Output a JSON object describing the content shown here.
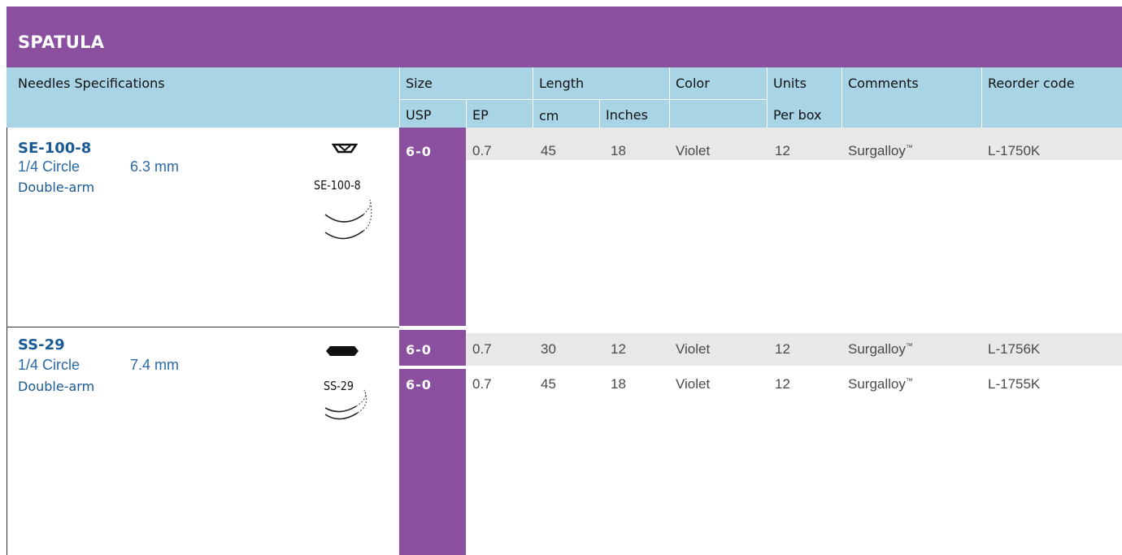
{
  "section_title": "SPATULA",
  "header": {
    "needles": "Needles Specifications",
    "size": "Size",
    "usp": "USP",
    "ep": "EP",
    "length": "Length",
    "cm": "cm",
    "inches": "Inches",
    "color": "Color",
    "units": "Units",
    "per_box": "Per box",
    "comments": "Comments",
    "reorder": "Reorder code"
  },
  "groups": [
    {
      "needle": {
        "code": "SE-100-8",
        "circle": "1/4 Circle",
        "length": "6.3 mm",
        "arm": "Double-arm",
        "diagram_label": "SE-100-8",
        "cross_section_icon": "spatula-cross-section-icon"
      },
      "rows": [
        {
          "usp": "6-0",
          "ep": "0.7",
          "cm": "45",
          "inches": "18",
          "color": "Violet",
          "units": "12",
          "comment": "Surgalloy",
          "tm": "™",
          "code": "L-1750K"
        }
      ]
    },
    {
      "needle": {
        "code": "SS-29",
        "circle": "1/4 Circle",
        "length": "7.4 mm",
        "arm": "Double-arm",
        "diagram_label": "SS-29",
        "cross_section_icon": "hexagon-cross-section-icon"
      },
      "rows": [
        {
          "usp": "6-0",
          "ep": "0.7",
          "cm": "30",
          "inches": "12",
          "color": "Violet",
          "units": "12",
          "comment": "Surgalloy",
          "tm": "™",
          "code": "L-1756K"
        },
        {
          "usp": "6-0",
          "ep": "0.7",
          "cm": "45",
          "inches": "18",
          "color": "Violet",
          "units": "12",
          "comment": "Surgalloy",
          "tm": "™",
          "code": "L-1755K"
        }
      ]
    }
  ],
  "colors": {
    "purple": "#8a509f",
    "header_blue": "#a8d4e6",
    "band_gray": "#e8e8e9",
    "name_blue": "#1a5a94"
  }
}
